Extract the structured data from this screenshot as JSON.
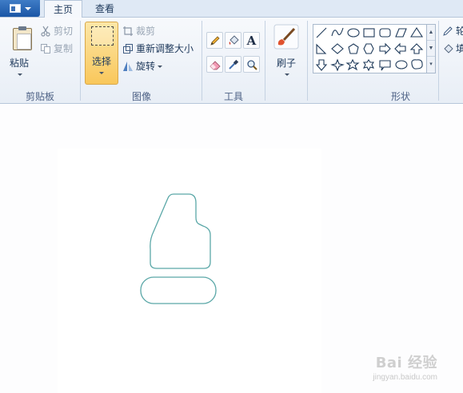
{
  "tabs": {
    "home": "主页",
    "view": "查看"
  },
  "clipboard": {
    "paste": "粘贴",
    "cut": "剪切",
    "copy": "复制",
    "group": "剪贴板"
  },
  "image": {
    "select": "选择",
    "crop": "裁剪",
    "resize": "重新调整大小",
    "rotate": "旋转",
    "group": "图像"
  },
  "tools": {
    "group": "工具",
    "text_glyph": "A"
  },
  "brushes": {
    "label": "刷子"
  },
  "shapes": {
    "group": "形状"
  },
  "right_cut": {
    "top": "轮",
    "bottom": "填"
  },
  "watermark": {
    "main": "Bai 经验",
    "sub": "jingyan.baidu.com"
  },
  "colors": {
    "ribbon_bg": "#eef3f9",
    "accent_selected": "#f9c75b",
    "drawing_stroke": "#5aa7a7",
    "text": "#1e395b"
  }
}
